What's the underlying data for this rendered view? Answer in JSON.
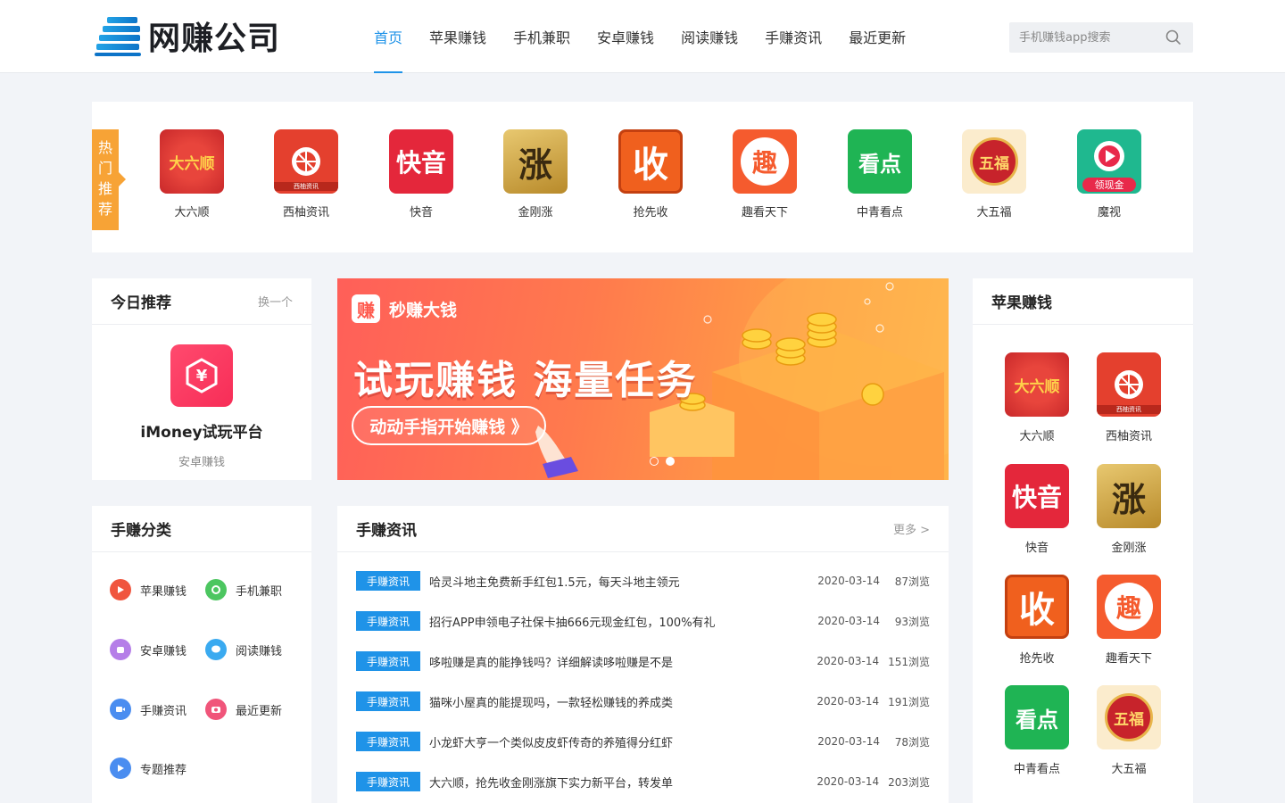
{
  "header": {
    "logo_text": "网赚公司",
    "nav": [
      "首页",
      "苹果赚钱",
      "手机兼职",
      "安卓赚钱",
      "阅读赚钱",
      "手赚资讯",
      "最近更新"
    ],
    "active_nav": 0,
    "search_placeholder": "手机赚钱app搜索"
  },
  "hot": {
    "tag": "热门推荐",
    "apps": [
      {
        "name": "大六顺",
        "icon": "daliushun-icon"
      },
      {
        "name": "西柚资讯",
        "icon": "xiyou-icon"
      },
      {
        "name": "快音",
        "icon": "kuaiyin-icon"
      },
      {
        "name": "金刚涨",
        "icon": "jingangzhang-icon"
      },
      {
        "name": "抢先收",
        "icon": "qiangxianshou-icon"
      },
      {
        "name": "趣看天下",
        "icon": "qukan-icon"
      },
      {
        "name": "中青看点",
        "icon": "zhongqing-icon"
      },
      {
        "name": "大五福",
        "icon": "dawufu-icon"
      },
      {
        "name": "魔视",
        "icon": "moshi-icon"
      }
    ]
  },
  "icon_text": {
    "daliushun": "大六顺",
    "xiyou_small": "西柚资讯",
    "kuaiyin": "快音",
    "jingangzhang": "涨",
    "qiangxianshou": "收",
    "qukan": "趣",
    "zhongqing": "看点",
    "dawufu": "五福",
    "moshi": "领现金",
    "yen": "¥"
  },
  "today": {
    "title": "今日推荐",
    "switch_label": "换一个",
    "app_name": "iMoney试玩平台",
    "app_category": "安卓赚钱"
  },
  "banner": {
    "logo_char": "赚",
    "logo_text": "秒赚大钱",
    "title": "试玩赚钱 海量任务",
    "button": "动动手指开始赚钱 》",
    "slides": 2,
    "active_slide": 1
  },
  "apple": {
    "title": "苹果赚钱",
    "apps": [
      {
        "name": "大六顺"
      },
      {
        "name": "西柚资讯"
      },
      {
        "name": "快音"
      },
      {
        "name": "金刚涨"
      },
      {
        "name": "抢先收"
      },
      {
        "name": "趣看天下"
      },
      {
        "name": "中青看点"
      },
      {
        "name": "大五福"
      }
    ]
  },
  "categories": {
    "title": "手赚分类",
    "items": [
      {
        "label": "苹果赚钱",
        "color": "#f0553e"
      },
      {
        "label": "手机兼职",
        "color": "#4cc660"
      },
      {
        "label": "安卓赚钱",
        "color": "#b57ee8"
      },
      {
        "label": "阅读赚钱",
        "color": "#3aaaf0"
      },
      {
        "label": "手赚资讯",
        "color": "#4a8df0"
      },
      {
        "label": "最近更新",
        "color": "#f0557a"
      },
      {
        "label": "专题推荐",
        "color": "#4a8df0"
      }
    ]
  },
  "news": {
    "title": "手赚资讯",
    "more": "更多 >",
    "items": [
      {
        "tag": "手赚资讯",
        "title": "哈灵斗地主免费新手红包1.5元，每天斗地主领元",
        "date": "2020-03-14",
        "views": "87浏览"
      },
      {
        "tag": "手赚资讯",
        "title": "招行APP申领电子社保卡抽666元现金红包，100%有礼",
        "date": "2020-03-14",
        "views": "93浏览"
      },
      {
        "tag": "手赚资讯",
        "title": "哆啦赚是真的能挣钱吗？详细解读哆啦赚是不是",
        "date": "2020-03-14",
        "views": "151浏览"
      },
      {
        "tag": "手赚资讯",
        "title": "猫咪小屋真的能提现吗，一款轻松赚钱的养成类",
        "date": "2020-03-14",
        "views": "191浏览"
      },
      {
        "tag": "手赚资讯",
        "title": "小龙虾大亨一个类似皮皮虾传奇的养殖得分红虾",
        "date": "2020-03-14",
        "views": "78浏览"
      },
      {
        "tag": "手赚资讯",
        "title": "大六顺，抢先收金刚涨旗下实力新平台，转发单",
        "date": "2020-03-14",
        "views": "203浏览"
      }
    ]
  }
}
